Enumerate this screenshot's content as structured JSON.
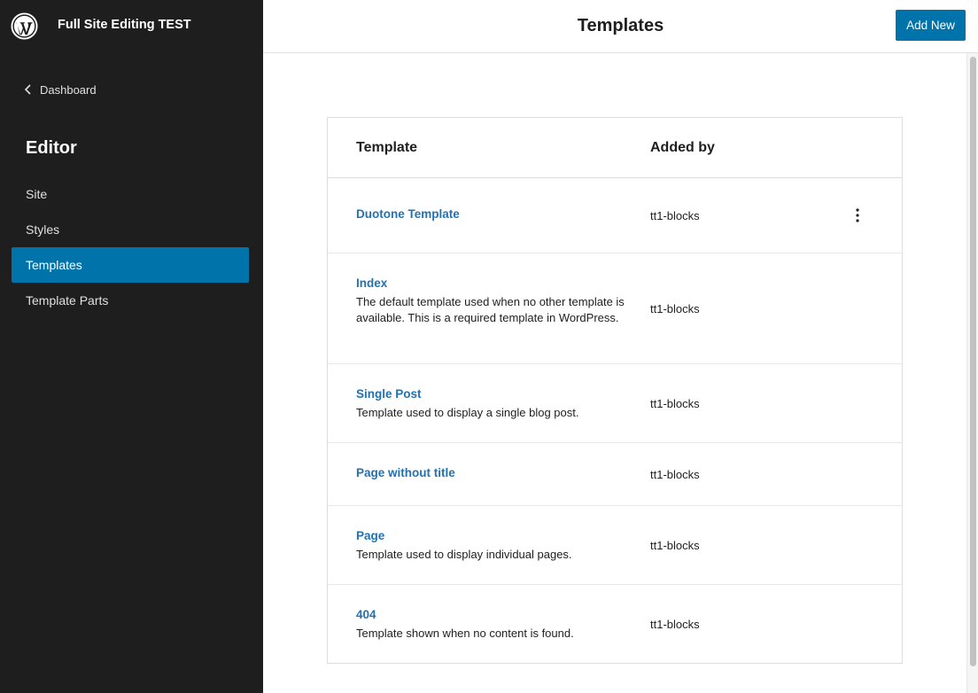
{
  "sidebar": {
    "site_title": "Full Site Editing TEST",
    "back_label": "Dashboard",
    "heading": "Editor",
    "nav": [
      {
        "label": "Site",
        "active": false
      },
      {
        "label": "Styles",
        "active": false
      },
      {
        "label": "Templates",
        "active": true
      },
      {
        "label": "Template Parts",
        "active": false
      }
    ]
  },
  "header": {
    "title": "Templates",
    "add_new_label": "Add New"
  },
  "table": {
    "columns": [
      "Template",
      "Added by"
    ],
    "rows": [
      {
        "title": "Duotone Template",
        "description": "",
        "added_by": "tt1-blocks",
        "has_actions": true
      },
      {
        "title": "Index",
        "description": "The default template used when no other template is available. This is a required template in WordPress.",
        "added_by": "tt1-blocks",
        "has_actions": false
      },
      {
        "title": "Single Post",
        "description": "Template used to display a single blog post.",
        "added_by": "tt1-blocks",
        "has_actions": false
      },
      {
        "title": "Page without title",
        "description": "",
        "added_by": "tt1-blocks",
        "has_actions": false
      },
      {
        "title": "Page",
        "description": "Template used to display individual pages.",
        "added_by": "tt1-blocks",
        "has_actions": false
      },
      {
        "title": "404",
        "description": "Template shown when no content is found.",
        "added_by": "tt1-blocks",
        "has_actions": false
      }
    ]
  },
  "icons": {
    "logo": "wordpress-logo-icon",
    "back": "chevron-left-icon",
    "row_actions": "more-vertical-icon"
  },
  "colors": {
    "sidebar_bg": "#1e1e1e",
    "accent": "#0073aa",
    "link": "#2271b1"
  }
}
